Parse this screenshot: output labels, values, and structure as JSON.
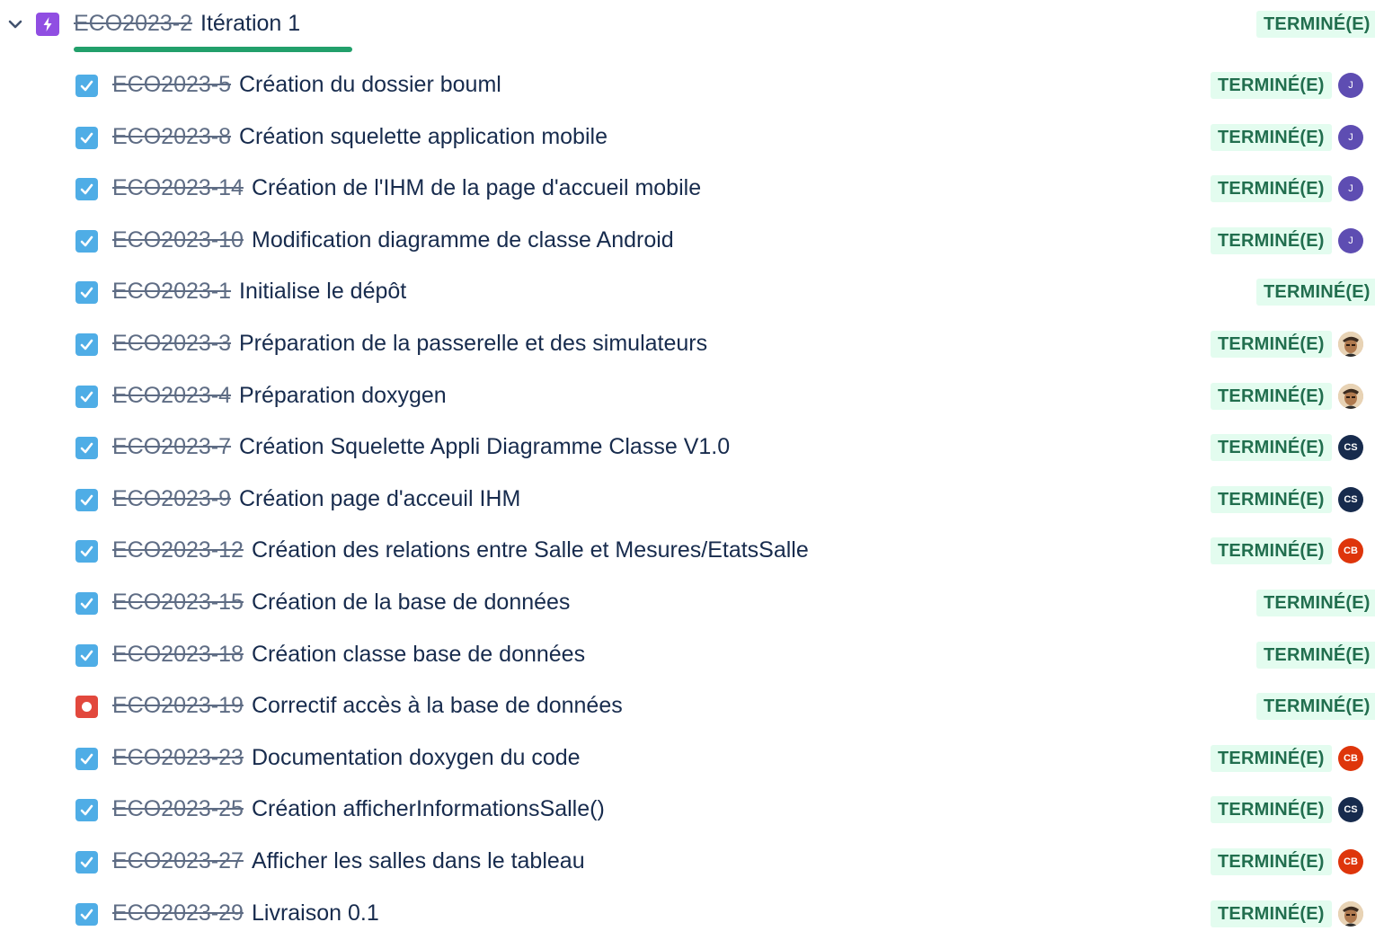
{
  "epic": {
    "key": "ECO2023-2",
    "title": "Itération 1",
    "status": "TERMINÉ(E)",
    "progress_done_fraction": 1.0
  },
  "issues": [
    {
      "type": "task",
      "key": "ECO2023-5",
      "title": "Création du dossier bouml",
      "status": "TERMINÉ(E)",
      "assignee": "J"
    },
    {
      "type": "task",
      "key": "ECO2023-8",
      "title": "Création squelette application mobile",
      "status": "TERMINÉ(E)",
      "assignee": "J"
    },
    {
      "type": "task",
      "key": "ECO2023-14",
      "title": "Création de l'IHM de la page d'accueil mobile",
      "status": "TERMINÉ(E)",
      "assignee": "J"
    },
    {
      "type": "task",
      "key": "ECO2023-10",
      "title": "Modification diagramme de classe Android",
      "status": "TERMINÉ(E)",
      "assignee": "J"
    },
    {
      "type": "task",
      "key": "ECO2023-1",
      "title": "Initialise le dépôt",
      "status": "TERMINÉ(E)",
      "assignee": ""
    },
    {
      "type": "task",
      "key": "ECO2023-3",
      "title": "Préparation de la passerelle et des simulateurs",
      "status": "TERMINÉ(E)",
      "assignee": "photo"
    },
    {
      "type": "task",
      "key": "ECO2023-4",
      "title": "Préparation doxygen",
      "status": "TERMINÉ(E)",
      "assignee": "photo"
    },
    {
      "type": "task",
      "key": "ECO2023-7",
      "title": "Création Squelette Appli Diagramme Classe V1.0",
      "status": "TERMINÉ(E)",
      "assignee": "CS"
    },
    {
      "type": "task",
      "key": "ECO2023-9",
      "title": "Création page d'acceuil IHM",
      "status": "TERMINÉ(E)",
      "assignee": "CS"
    },
    {
      "type": "task",
      "key": "ECO2023-12",
      "title": "Création des relations entre Salle et Mesures/EtatsSalle",
      "status": "TERMINÉ(E)",
      "assignee": "CB"
    },
    {
      "type": "task",
      "key": "ECO2023-15",
      "title": "Création de la base de données",
      "status": "TERMINÉ(E)",
      "assignee": ""
    },
    {
      "type": "task",
      "key": "ECO2023-18",
      "title": "Création classe base de données",
      "status": "TERMINÉ(E)",
      "assignee": ""
    },
    {
      "type": "bug",
      "key": "ECO2023-19",
      "title": "Correctif accès à la base de données",
      "status": "TERMINÉ(E)",
      "assignee": ""
    },
    {
      "type": "task",
      "key": "ECO2023-23",
      "title": "Documentation doxygen du code",
      "status": "TERMINÉ(E)",
      "assignee": "CB"
    },
    {
      "type": "task",
      "key": "ECO2023-25",
      "title": "Création afficherInformationsSalle()",
      "status": "TERMINÉ(E)",
      "assignee": "CS"
    },
    {
      "type": "task",
      "key": "ECO2023-27",
      "title": "Afficher les salles dans le tableau",
      "status": "TERMINÉ(E)",
      "assignee": "CB"
    },
    {
      "type": "task",
      "key": "ECO2023-29",
      "title": "Livraison 0.1",
      "status": "TERMINÉ(E)",
      "assignee": "photo"
    }
  ],
  "colors": {
    "done_lozenge_bg": "#e3fcef",
    "done_lozenge_text": "#216e4e",
    "task_icon": "#4fade6",
    "bug_icon": "#e2483d",
    "epic_icon": "#904ee2",
    "progress": "#22a06b"
  }
}
